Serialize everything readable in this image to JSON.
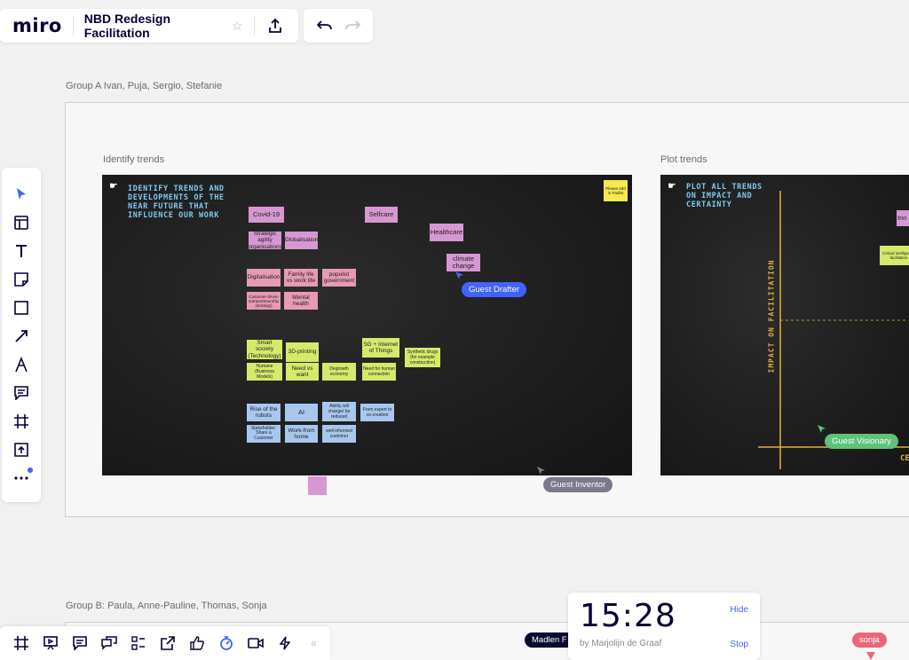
{
  "app": {
    "logo": "miro",
    "board_title": "NBD Redesign Facilitation"
  },
  "frames": {
    "group_a_label": "Group A Ivan, Puja, Sergio, Stefanie",
    "group_b_label": "Group B: Paula, Anne-Pauline, Thomas, Sonja",
    "identify_label": "Identify trends",
    "plot_label": "Plot trends"
  },
  "identify_board": {
    "title": "IDENTIFY TRENDS AND DEVELOPMENTS OF THE NEAR FUTURE THAT INFLUENCE OUR WORK",
    "small_note": "Please add in Padlet",
    "notes": {
      "covid": "Covid-19",
      "selfcare": "Selfcare",
      "healthcare": "Healthcare",
      "climate": "climate change",
      "strategic": "Strategic agility (organisations)",
      "globalisation": "Globalisation",
      "digitalisation": "Digitalisation",
      "family": "Family life vs work life",
      "populist": "populist government",
      "customer": "Customer-driven entrepreneurship (strategy)",
      "mental": "Mental health",
      "smart": "Smart society (Technology)",
      "print3d": "3D-printing",
      "iot": "5G + Internet of Things",
      "synthetic": "Synthetic drugs (for example construction)",
      "humane": "Humane (Business Models)",
      "needwant": "Need vs want",
      "degrowth": "Degrowth economy",
      "human": "Need for human connection",
      "robots": "Rise of the robots",
      "ai": "AI",
      "ability": "Ability will change/ be reduced",
      "expert": "From expert to co-creation",
      "stakeholder": "Stakeholder: Share a Customer",
      "wfh": "Work-from home",
      "informed": "well-informed customer"
    }
  },
  "plot_board": {
    "title": "PLOT ALL TRENDS ON IMPACT AND CERTAINTY",
    "y_axis": "IMPACT ON FACILITATION",
    "x_axis_partial": "CE",
    "note_inn": "Inn",
    "note_critical": "Critical intelligence facilitation"
  },
  "cursors": {
    "drafter": "Guest Drafter",
    "inventor": "Guest Inventor",
    "visionary": "Guest Visionary",
    "madlen": "Madlen F",
    "sonja": "sonja"
  },
  "timer": {
    "time": "15:28",
    "by": "by Marjolijn de Graaf",
    "hide": "Hide",
    "stop": "Stop"
  },
  "colors": {
    "accent": "#4262ff",
    "chalk": "#7fc8f0",
    "axis": "#e3b23c"
  }
}
